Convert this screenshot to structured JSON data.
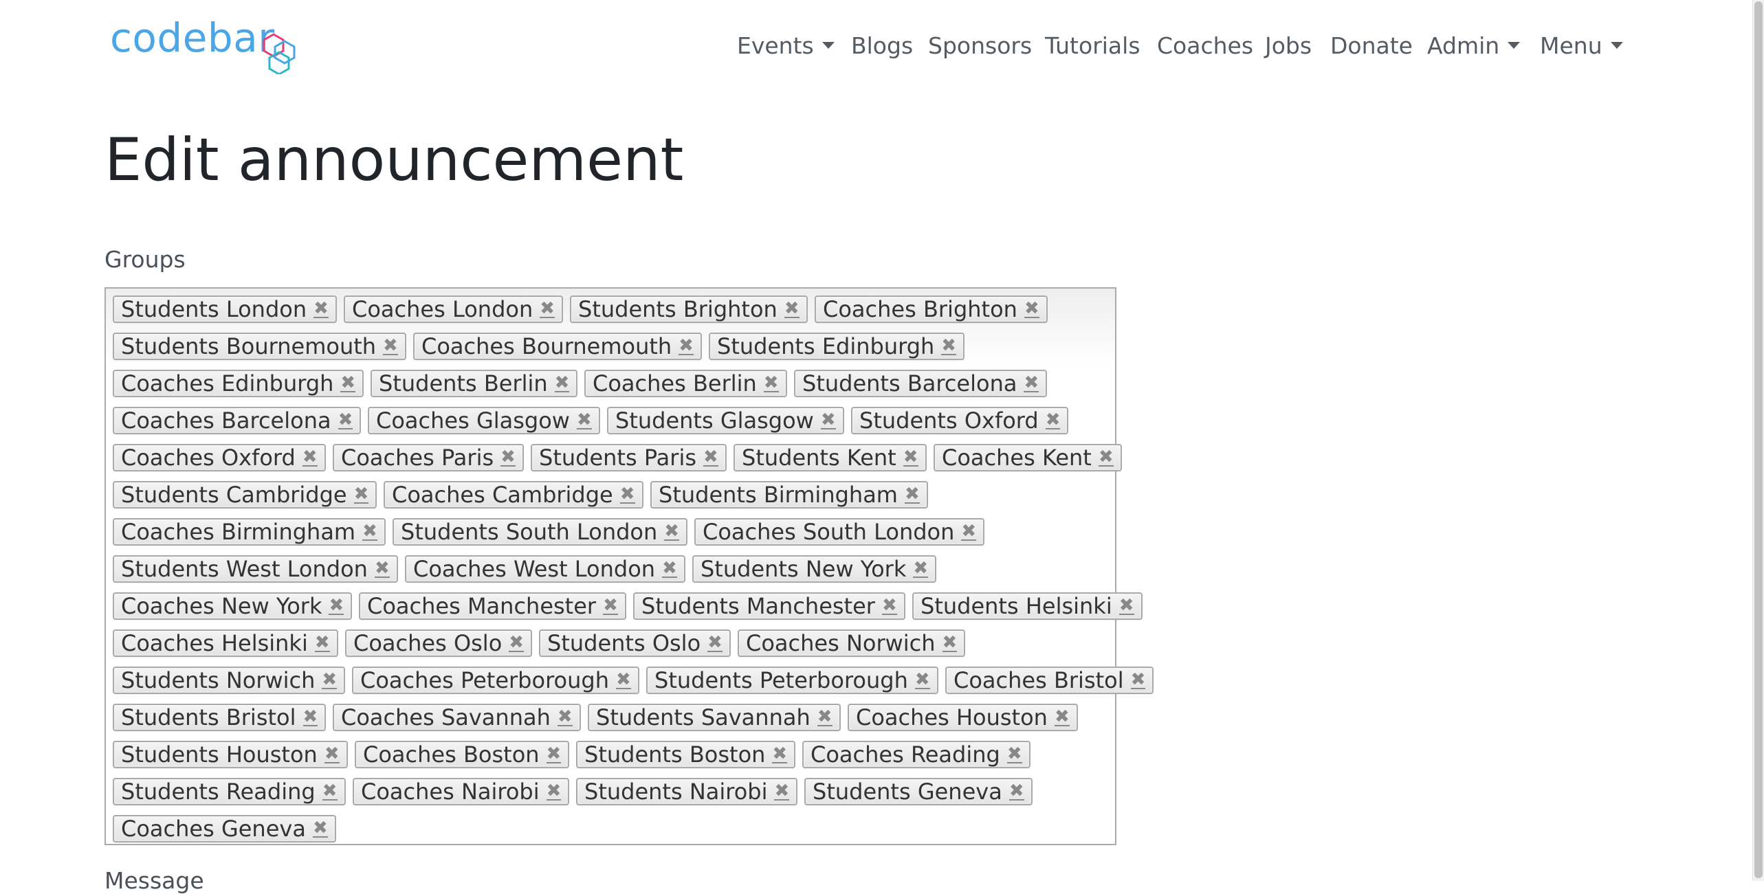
{
  "nav": {
    "logo_text": "codebar",
    "items": [
      {
        "label": "Events",
        "dropdown": true
      },
      {
        "label": "Blogs",
        "dropdown": false
      },
      {
        "label": "Sponsors",
        "dropdown": false
      },
      {
        "label": "Tutorials",
        "dropdown": false
      },
      {
        "label": "Coaches",
        "dropdown": false
      },
      {
        "label": "Jobs",
        "dropdown": false
      },
      {
        "label": "Donate",
        "dropdown": false
      },
      {
        "label": "Admin",
        "dropdown": true
      },
      {
        "label": "Menu",
        "dropdown": true
      }
    ]
  },
  "page": {
    "title": "Edit announcement",
    "groups_label": "Groups",
    "next_label": "Message"
  },
  "colors": {
    "logo": "#4ba6e8",
    "logo_mark_pink": "#e63e7a",
    "logo_mark_blue": "#4ba6e8",
    "tag_border": "#aaaaaa"
  },
  "group_rows": [
    [
      "Students London",
      "Coaches London",
      "Students Brighton",
      "Coaches Brighton"
    ],
    [
      "Students Bournemouth",
      "Coaches Bournemouth",
      "Students Edinburgh"
    ],
    [
      "Coaches Edinburgh",
      "Students Berlin",
      "Coaches Berlin",
      "Students Barcelona"
    ],
    [
      "Coaches Barcelona",
      "Coaches Glasgow",
      "Students Glasgow",
      "Students Oxford"
    ],
    [
      "Coaches Oxford",
      "Coaches Paris",
      "Students Paris",
      "Students Kent",
      "Coaches Kent"
    ],
    [
      "Students Cambridge",
      "Coaches Cambridge",
      "Students Birmingham"
    ],
    [
      "Coaches Birmingham",
      "Students South London",
      "Coaches South London"
    ],
    [
      "Students West London",
      "Coaches West London",
      "Students New York"
    ],
    [
      "Coaches New York",
      "Coaches Manchester",
      "Students Manchester",
      "Students Helsinki"
    ],
    [
      "Coaches Helsinki",
      "Coaches Oslo",
      "Students Oslo",
      "Coaches Norwich"
    ],
    [
      "Students Norwich",
      "Coaches Peterborough",
      "Students Peterborough",
      "Coaches Bristol"
    ],
    [
      "Students Bristol",
      "Coaches Savannah",
      "Students Savannah",
      "Coaches Houston"
    ],
    [
      "Students Houston",
      "Coaches Boston",
      "Students Boston",
      "Coaches Reading"
    ],
    [
      "Students Reading",
      "Coaches Nairobi",
      "Students Nairobi",
      "Students Geneva"
    ],
    [
      "Coaches Geneva"
    ]
  ],
  "remove_glyph": "✖"
}
